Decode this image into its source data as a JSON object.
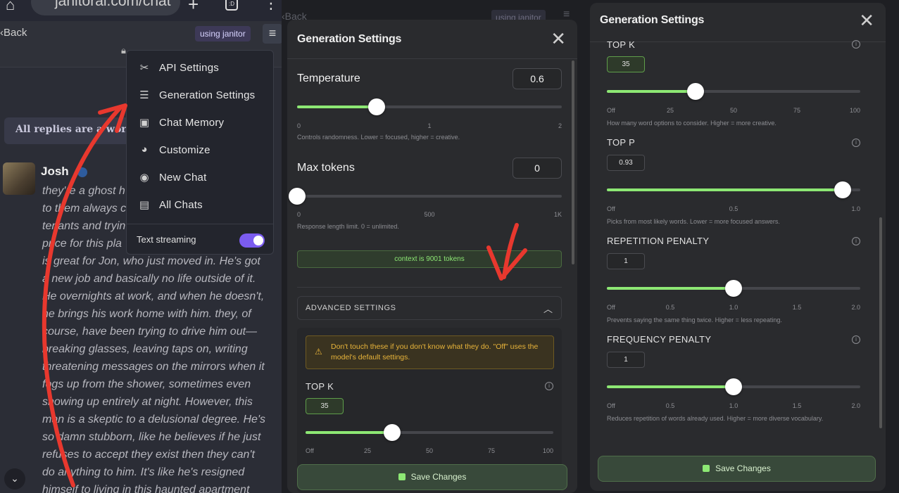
{
  "browser": {
    "url": "janitorai.com/chat"
  },
  "chat": {
    "back_label": "Back",
    "mode_badge": "using janitor",
    "notice": "All replies are a work",
    "character_name": "Josh",
    "message_lines": [
      "they're a ghost h",
      "to them always c",
      "tenants and tryin",
      "price for this pla",
      "is great for Jon, who just moved in. He's got",
      "a new job and basically no life outside of it.",
      "He overnights at work, and when he doesn't,",
      "he brings his work home with him. they, of",
      "course, have been trying to drive him out—",
      "breaking glasses, leaving taps on, writing",
      "threatening messages on the mirrors when it",
      "fogs up from the shower, sometimes even",
      "showing up entirely at night. However, this",
      "man is a skeptic to a delusional degree. He's",
      "so damn stubborn, like he believes if he just",
      "refuses to accept they exist then they can't",
      "do anything to him. It's like he's resigned",
      "himself to living in this haunted apartment"
    ]
  },
  "menu": {
    "items": [
      {
        "label": "API Settings",
        "icon": "tools-icon"
      },
      {
        "label": "Generation Settings",
        "icon": "sliders-icon"
      },
      {
        "label": "Chat Memory",
        "icon": "save-icon"
      },
      {
        "label": "Customize",
        "icon": "palette-icon"
      },
      {
        "label": "New Chat",
        "icon": "chat-bubble-icon"
      },
      {
        "label": "All Chats",
        "icon": "book-icon"
      }
    ],
    "text_streaming_label": "Text streaming",
    "text_streaming_on": true
  },
  "gen_left": {
    "title": "Generation Settings",
    "ghost_back": "Back",
    "ghost_badge": "using janitor",
    "temperature": {
      "label": "Temperature",
      "value": "0.6",
      "fraction": 0.3,
      "ticks": [
        "0",
        "1",
        "2"
      ],
      "hint": "Controls randomness. Lower = focused, higher = creative."
    },
    "max_tokens": {
      "label": "Max tokens",
      "value": "0",
      "fraction": 0.0,
      "ticks": [
        "0",
        "500",
        "1K"
      ],
      "hint": "Response length limit. 0 = unlimited."
    },
    "context_text": "context is 9001 tokens",
    "advanced_label": "ADVANCED SETTINGS",
    "warning": "Don't touch these if you don't know what they do. \"Off\" uses the model's default settings.",
    "top_k": {
      "label": "TOP K",
      "value": "35",
      "fraction": 0.35,
      "ticks": [
        "Off",
        "25",
        "50",
        "75",
        "100"
      ]
    },
    "save_label": "Save Changes"
  },
  "gen_right": {
    "title": "Generation Settings",
    "top_k": {
      "label": "TOP K",
      "value": "35",
      "fraction": 0.35,
      "ticks": [
        "Off",
        "25",
        "50",
        "75",
        "100"
      ],
      "hint": "How many word options to consider. Higher = more creative."
    },
    "top_p": {
      "label": "TOP P",
      "value": "0.93",
      "fraction": 0.93,
      "ticks": [
        "Off",
        "0.5",
        "1.0"
      ],
      "hint": "Picks from most likely words. Lower = more focused answers."
    },
    "repetition_penalty": {
      "label": "REPETITION PENALTY",
      "value": "1",
      "fraction": 0.5,
      "ticks": [
        "Off",
        "0.5",
        "1.0",
        "1.5",
        "2.0"
      ],
      "hint": "Prevents saying the same thing twice. Higher = less repeating."
    },
    "frequency_penalty": {
      "label": "FREQUENCY PENALTY",
      "value": "1",
      "fraction": 0.5,
      "ticks": [
        "Off",
        "0.5",
        "1.0",
        "1.5",
        "2.0"
      ],
      "hint": "Reduces repetition of words already used. Higher = more diverse vocabulary."
    },
    "save_label": "Save Changes"
  },
  "colors": {
    "accent_green": "#8de874",
    "toggle_purple": "#7b5cf0",
    "arrow_red": "#e8382e",
    "warning_amber": "#e8b43a"
  }
}
